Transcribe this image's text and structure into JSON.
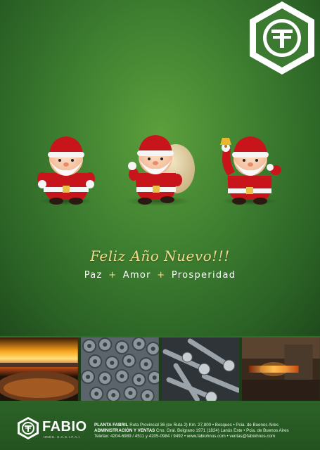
{
  "headline": "Feliz Año Nuevo!!!",
  "tagline": {
    "word1": "Paz",
    "sep1": "+",
    "word2": "Amor",
    "sep2": "+",
    "word3": "Prosperidad"
  },
  "logo": {
    "mark": "F"
  },
  "footer": {
    "brand": "FABIO",
    "brand_sub": "HNOS. S.A.C.I.F.A.I.",
    "line1_label": "PLANTA FABRIL",
    "line1_text": "Ruta Provincial 36 (ex Ruta 2) Km. 27,800 • Bosques • Pcia. de Buenos Aires",
    "line2_label": "ADMINISTRACIÓN Y VENTAS",
    "line2_text": "Cno. Gral. Belgrano 1971 (1824) Lanús Este • Pcia. de Buenos Aires",
    "line3_text": "Telefax: 4204-6989 / 4511 y 4205-0984 / 9492 • www.fabiohnos.com • ventas@fabiohnos.com"
  },
  "colors": {
    "background_green": "#3f8131",
    "headline_gold": "#f0d98a",
    "santa_red": "#c8141b"
  },
  "images": [
    "santa-standing",
    "santa-with-sack",
    "santa-with-bell",
    "furnace-photo",
    "nuts-photo",
    "bolts-photo",
    "forging-photo"
  ]
}
